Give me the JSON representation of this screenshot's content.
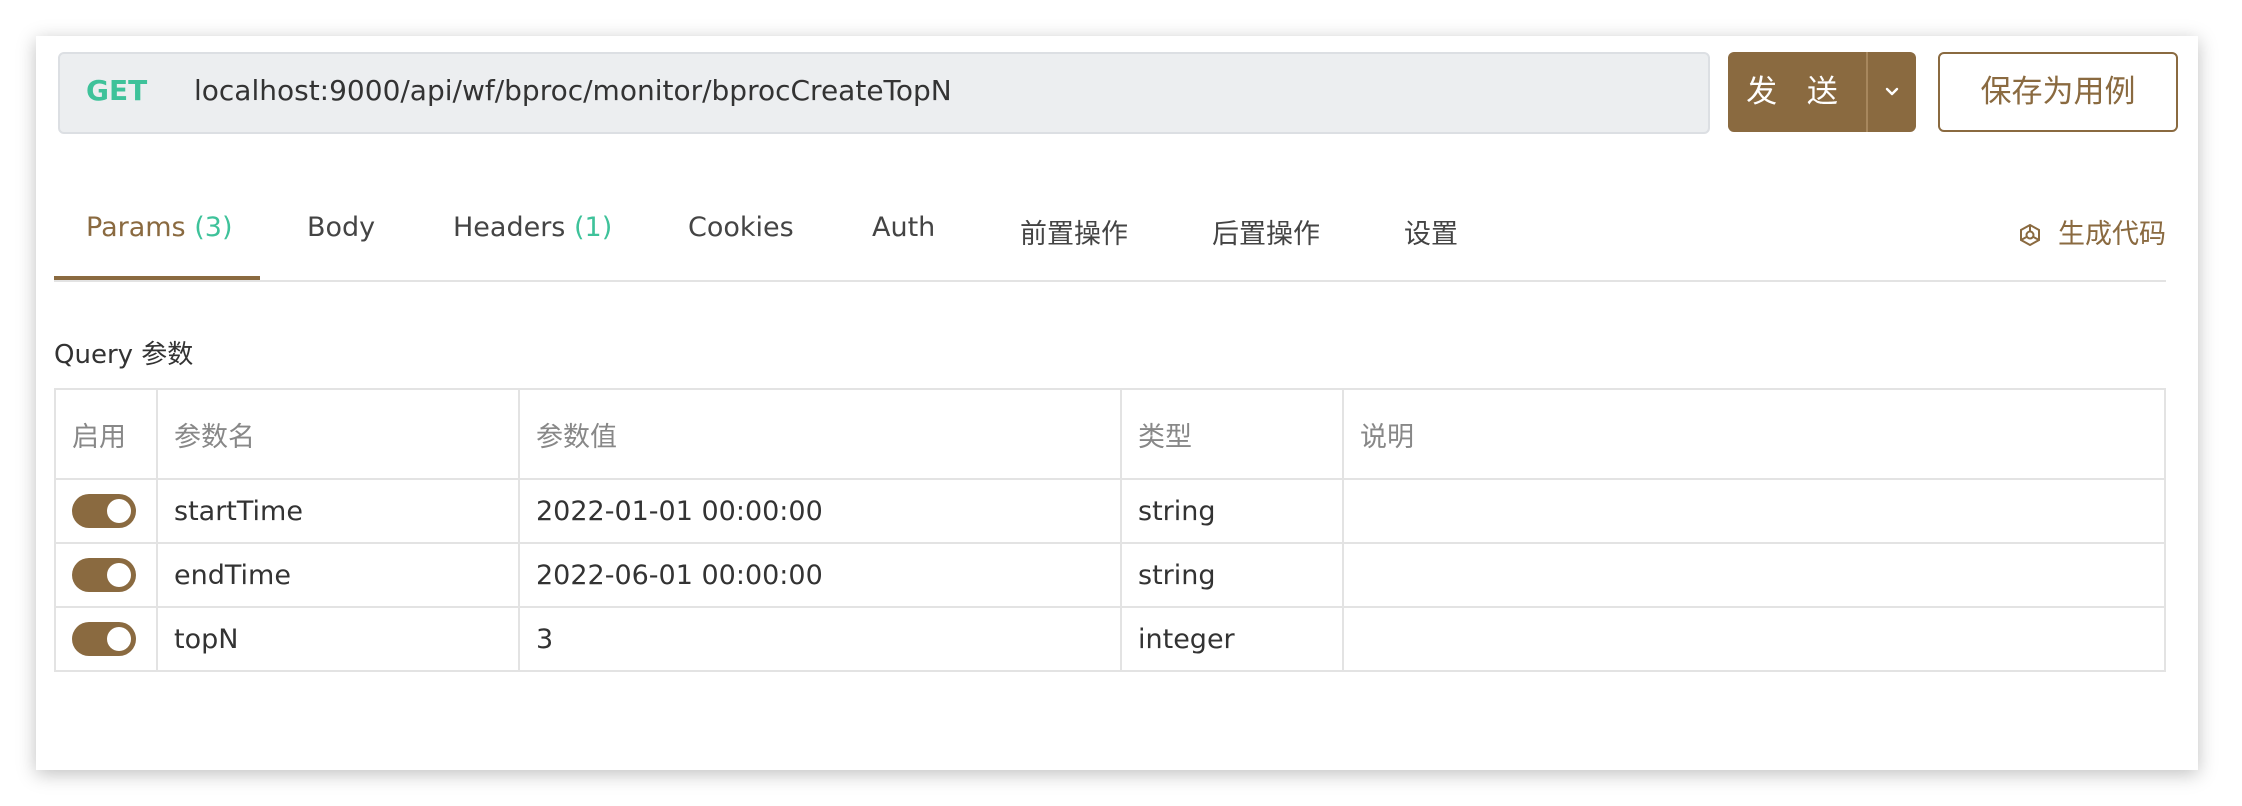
{
  "request": {
    "method": "GET",
    "url": "localhost:9000/api/wf/bproc/monitor/bprocCreateTopN"
  },
  "actions": {
    "send_label": "发 送",
    "save_label": "保存为用例"
  },
  "tabs": [
    {
      "label": "Params",
      "count": "(3)",
      "active": true
    },
    {
      "label": "Body"
    },
    {
      "label": "Headers",
      "count": "(1)"
    },
    {
      "label": "Cookies"
    },
    {
      "label": "Auth"
    },
    {
      "label": "前置操作"
    },
    {
      "label": "后置操作"
    },
    {
      "label": "设置"
    }
  ],
  "generate_code": {
    "label": "生成代码",
    "icon": "gear-cube-icon"
  },
  "query_section": {
    "title": "Query 参数"
  },
  "table": {
    "headers": [
      "启用",
      "参数名",
      "参数值",
      "类型",
      "说明"
    ],
    "rows": [
      {
        "enabled": true,
        "name": "startTime",
        "value": "2022-01-01 00:00:00",
        "type": "string",
        "description": ""
      },
      {
        "enabled": true,
        "name": "endTime",
        "value": "2022-06-01 00:00:00",
        "type": "string",
        "description": ""
      },
      {
        "enabled": true,
        "name": "topN",
        "value": "3",
        "type": "integer",
        "description": ""
      }
    ]
  },
  "colors": {
    "accent": "#8a6a40",
    "method_green": "#3ec29a"
  }
}
